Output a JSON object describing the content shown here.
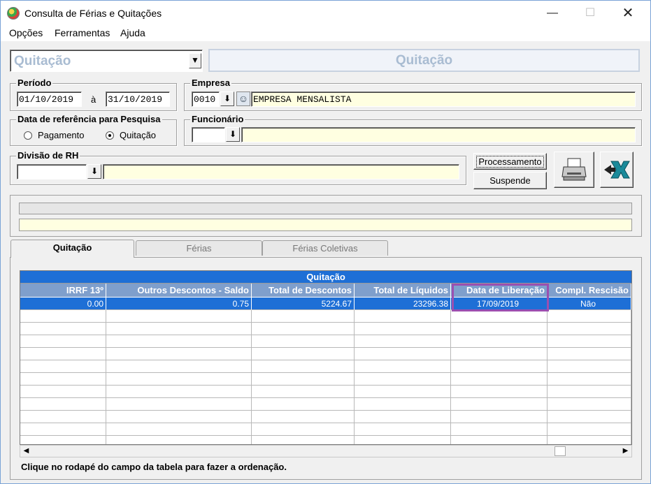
{
  "window": {
    "title": "Consulta de Férias e Quitações"
  },
  "menu": [
    "Opções",
    "Ferramentas",
    "Ajuda"
  ],
  "mode_select": {
    "value": "Quitação"
  },
  "mode_banner": "Quitação",
  "periodo": {
    "label": "Período",
    "from": "01/10/2019",
    "separator": "à",
    "to": "31/10/2019"
  },
  "empresa": {
    "label": "Empresa",
    "code": "0010",
    "name": "EMPRESA MENSALISTA"
  },
  "data_ref": {
    "label": "Data de referência para Pesquisa",
    "options": [
      "Pagamento",
      "Quitação"
    ],
    "selected": "Quitação"
  },
  "funcionario": {
    "label": "Funcionário",
    "code": "",
    "name": ""
  },
  "divisao": {
    "label": "Divisão de RH",
    "code": "",
    "name": ""
  },
  "buttons": {
    "processamento": "Processamento",
    "suspende": "Suspende"
  },
  "icons": {
    "print": "printer-icon",
    "excel": "excel-export-icon"
  },
  "tabs": [
    "Quitação",
    "Férias",
    "Férias Coletivas"
  ],
  "active_tab": "Quitação",
  "grid": {
    "title": "Quitação",
    "columns": [
      "IRRF 13º",
      "Outros Descontos - Saldo",
      "Total de Descontos",
      "Total de Líquidos",
      "Data de Liberação",
      "Compl. Rescisão"
    ],
    "rows": [
      [
        "0.00",
        "0.75",
        "5224.67",
        "23296.38",
        "17/09/2019",
        "Não"
      ]
    ]
  },
  "footer_note": "Clique no rodapé do campo da tabela  para fazer a ordenação.",
  "colors": {
    "selection": "#1e6fd6",
    "header": "#7f9fcc",
    "highlight": "#9b4fb0",
    "input_yellow": "#ffffe1"
  }
}
